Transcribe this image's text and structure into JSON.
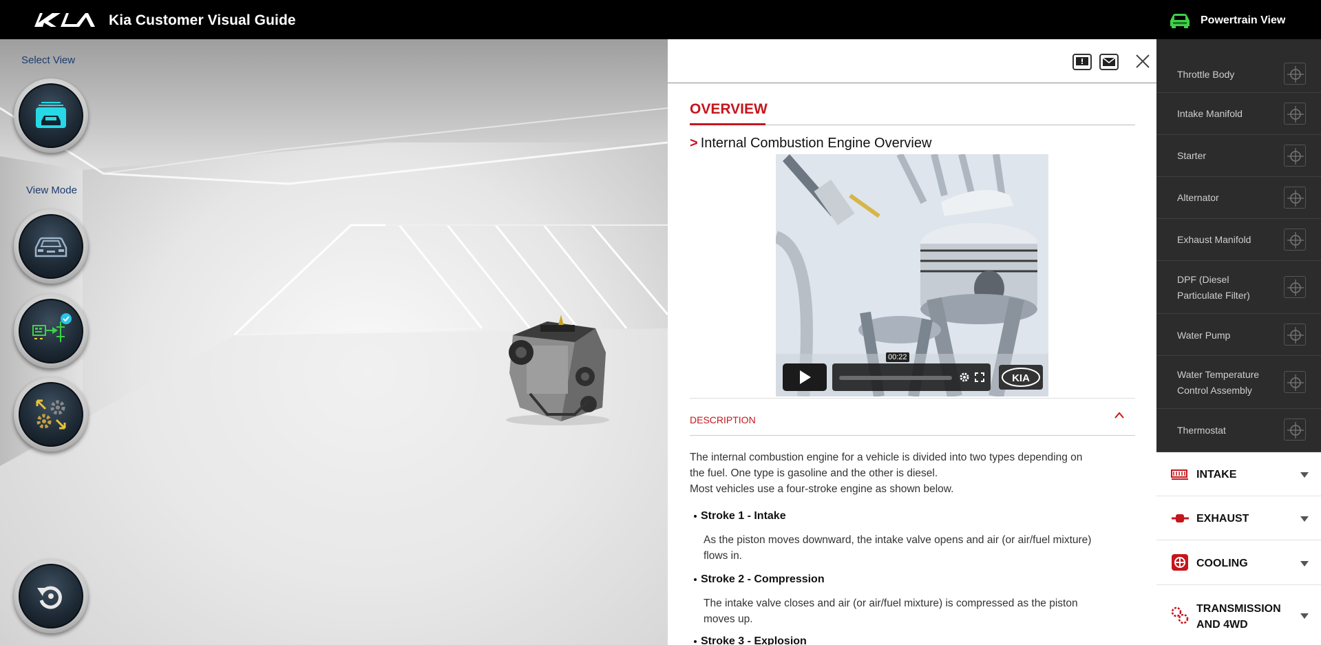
{
  "app": {
    "title": "Kia Customer Visual Guide",
    "view_label": "Powertrain View"
  },
  "sidebar": {
    "select_view_label": "Select View",
    "view_mode_label": "View Mode"
  },
  "panel": {
    "section": "OVERVIEW",
    "title": "Internal Combustion Engine Overview",
    "video": {
      "time": "00:22",
      "brand": "KIA"
    },
    "description_label": "DESCRIPTION",
    "intro_lines": [
      "The internal combustion engine for a vehicle is divided into two types depending on",
      "the fuel. One type is gasoline and the other is diesel.",
      "Most vehicles use a four-stroke engine as shown below."
    ],
    "strokes": [
      {
        "title": "Stroke 1 - Intake",
        "lines": [
          "As the piston moves downward, the intake valve opens and air (or air/fuel mixture)",
          "flows in."
        ]
      },
      {
        "title": "Stroke 2 - Compression",
        "lines": [
          "The intake valve closes and air (or air/fuel mixture) is compressed as the piston",
          "moves up."
        ]
      },
      {
        "title": "Stroke 3 - Explosion",
        "lines": []
      }
    ]
  },
  "parts": [
    {
      "lines": [
        "Throttle Body"
      ]
    },
    {
      "lines": [
        "Intake Manifold"
      ]
    },
    {
      "lines": [
        "Starter"
      ]
    },
    {
      "lines": [
        "Alternator"
      ]
    },
    {
      "lines": [
        "Exhaust Manifold"
      ]
    },
    {
      "lines": [
        "DPF (Diesel",
        "Particulate Filter)"
      ]
    },
    {
      "lines": [
        "Water Pump"
      ]
    },
    {
      "lines": [
        "Water Temperature",
        "Control Assembly"
      ]
    },
    {
      "lines": [
        "Thermostat"
      ]
    }
  ],
  "categories": [
    {
      "lines": [
        "INTAKE"
      ],
      "icon": "intake-icon"
    },
    {
      "lines": [
        "EXHAUST"
      ],
      "icon": "exhaust-icon"
    },
    {
      "lines": [
        "COOLING"
      ],
      "icon": "cooling-icon"
    },
    {
      "lines": [
        "TRANSMISSION",
        "AND 4WD"
      ],
      "icon": "transmission-icon"
    }
  ],
  "colors": {
    "accent": "#c5161d",
    "topbar": "#000000",
    "parts_bg": "#2c2c2c",
    "label_blue": "#1d3c6e"
  }
}
